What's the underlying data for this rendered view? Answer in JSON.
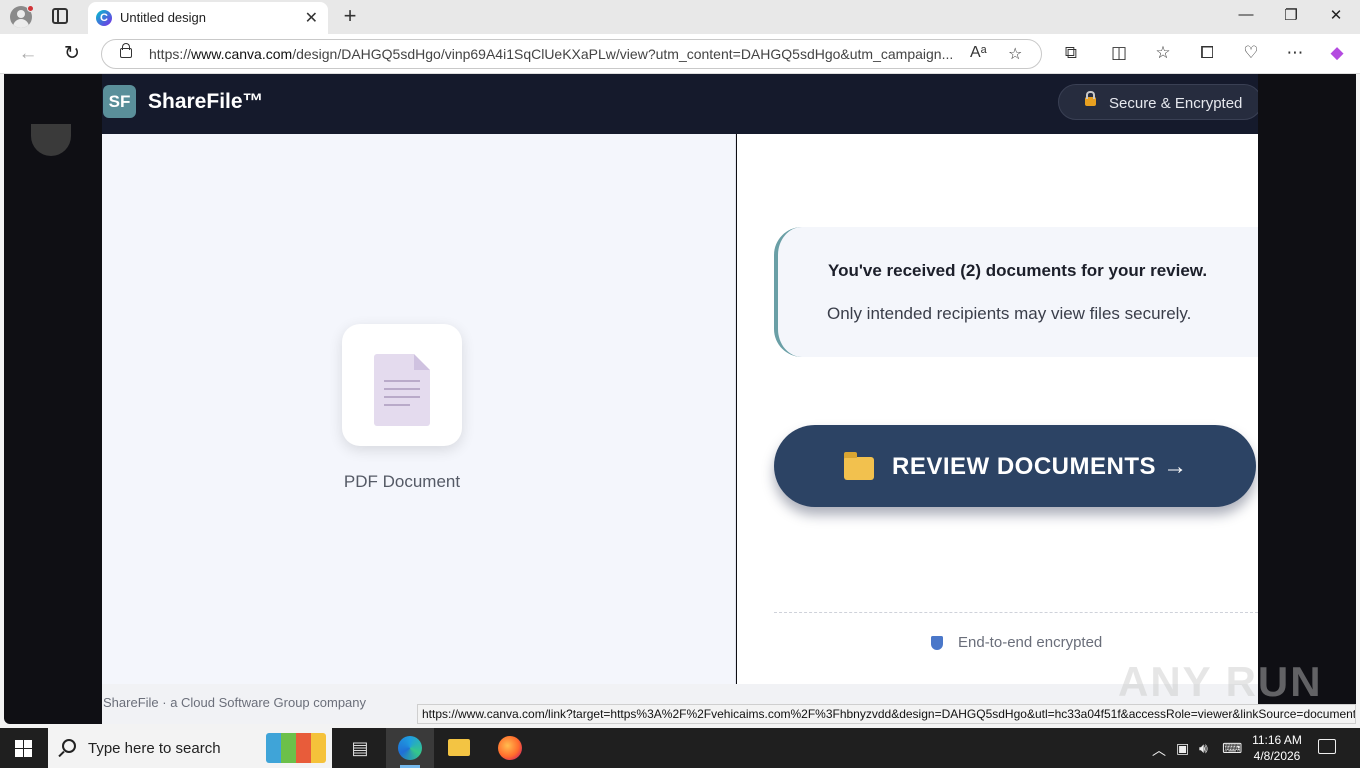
{
  "browser": {
    "tab_title": "Untitled design",
    "new_tab_label": "+",
    "url_prefix": "https://",
    "url_host": "www.canva.com",
    "url_path": "/design/DAHGQ5sdHgo/vinp69A4i1SqClUeKXaPLw/view?utm_content=DAHGQ5sdHgo&utm_campaign...",
    "status_url": "https://www.canva.com/link?target=https%3A%2F%2Fvehicaims.com%2F%3Fhbnyzvdd&design=DAHGQ5sdHgo&utl=hc33a04f51f&accessRole=viewer&linkSource=document"
  },
  "sharefile": {
    "logo_text": "SF",
    "brand_name": "ShareFile™",
    "secure_badge": "Secure & Encrypted",
    "document_label": "PDF Document",
    "message_title": "You've received (2) documents for your review.",
    "message_subtitle": "Only intended recipients may view files securely.",
    "review_button": "REVIEW DOCUMENTS →",
    "encryption_note": "End-to-end encrypted",
    "footer": "ShareFile · a Cloud Software Group company"
  },
  "watermark": "ANY RUN",
  "taskbar": {
    "search_placeholder": "Type here to search",
    "time": "11:16 AM",
    "date": "4/8/2026"
  },
  "colors": {
    "header_bg": "#151a2c",
    "button_bg": "#2c4364",
    "accent_teal": "#6a9fa6",
    "left_panel_bg": "#f4f6fc"
  }
}
